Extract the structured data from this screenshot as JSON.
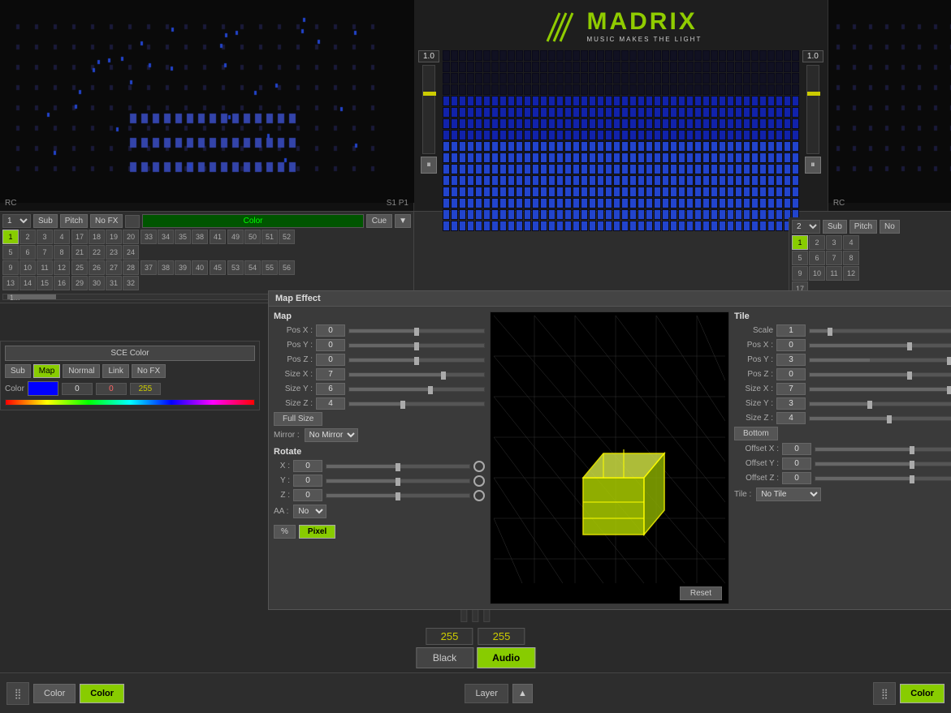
{
  "app": {
    "title": "MADRIX",
    "subtitle": "MUSIC MAKES THE LIGHT"
  },
  "left_channel": {
    "rc_label": "RC",
    "s1p1_label": "S1 P1",
    "strip_num": "1",
    "sub_btn": "Sub",
    "pitch_btn": "Pitch",
    "nofx_btn": "No FX",
    "color_label": "Color",
    "cue_btn": "Cue",
    "fader_value": "1.0",
    "scene_btn": "SCE Color",
    "sub2": "Sub",
    "map2": "Map",
    "normal2": "Normal",
    "link2": "Link",
    "nofx2": "No FX",
    "color_r": "0",
    "color_g": "0",
    "color_b": "255",
    "scroll_label": "1..."
  },
  "right_channel": {
    "rc_label": "RC",
    "strip_num": "2",
    "sub_btn": "Sub",
    "pitch_btn": "Pitch",
    "no_label": "No",
    "fader_value": "1.0"
  },
  "map_effect": {
    "title": "Map Effect",
    "map_section": "Map",
    "pos_x_label": "Pos X :",
    "pos_x_val": "0",
    "pos_y_label": "Pos Y :",
    "pos_y_val": "0",
    "pos_z_label": "Pos Z :",
    "pos_z_val": "0",
    "size_x_label": "Size X :",
    "size_x_val": "7",
    "size_y_label": "Size Y :",
    "size_y_val": "6",
    "size_z_label": "Size Z :",
    "size_z_val": "4",
    "full_size_btn": "Full Size",
    "mirror_label": "Mirror :",
    "mirror_val": "No Mirror",
    "rotate_section": "Rotate",
    "rot_x_label": "X :",
    "rot_x_val": "0",
    "rot_y_label": "Y :",
    "rot_y_val": "0",
    "rot_z_label": "Z :",
    "rot_z_val": "0",
    "aa_label": "AA :",
    "aa_val": "No",
    "pct_btn": "%",
    "pixel_btn": "Pixel",
    "reset_btn": "Reset"
  },
  "tile_panel": {
    "title": "Tile",
    "scale_label": "Scale",
    "scale_val": "1",
    "pos_x_label": "Pos X :",
    "pos_x_val": "0",
    "pos_y_label": "Pos Y :",
    "pos_y_val": "3",
    "pos_z_label": "Pos Z :",
    "pos_z_val": "0",
    "size_x_label": "Size X :",
    "size_x_val": "7",
    "size_y_label": "Size Y :",
    "size_y_val": "3",
    "size_z_label": "Size Z :",
    "size_z_val": "4",
    "bottom_btn": "Bottom",
    "offset_x_label": "Offset X :",
    "offset_x_val": "0",
    "offset_y_label": "Offset Y :",
    "offset_y_val": "0",
    "offset_z_label": "Offset Z :",
    "offset_z_val": "0",
    "tile_label": "Tile :",
    "tile_val": "No Tile"
  },
  "bottom_bar": {
    "color1_btn": "Color",
    "color2_btn": "Color",
    "color3_btn": "Color",
    "layer_btn": "Layer",
    "val_left": "255",
    "val_right": "255",
    "black_btn": "Black",
    "audio_btn": "Audio"
  },
  "grid_left": {
    "rows": [
      [
        "1",
        "2",
        "3",
        "4"
      ],
      [
        "5",
        "6",
        "7",
        "8"
      ],
      [
        "9",
        "10",
        "11",
        "12"
      ],
      [
        "13",
        "14",
        "15",
        "16"
      ]
    ],
    "rows2": [
      [
        "17",
        "18",
        "19",
        "20"
      ],
      [
        "21",
        "22",
        "23",
        "24"
      ],
      [
        "25",
        "26",
        "27",
        "28"
      ],
      [
        "29",
        "30",
        "31",
        "32"
      ]
    ],
    "rows3": [
      [
        "33",
        "34",
        "35",
        "38"
      ],
      [
        "37",
        "38",
        "39",
        "40"
      ],
      [
        "",
        "",
        "",
        ""
      ],
      [
        "",
        "",
        "",
        ""
      ]
    ],
    "rows4": [
      [
        "49",
        "50",
        "51",
        "52"
      ],
      [
        "53",
        "54",
        "55",
        "56"
      ],
      [
        "",
        "",
        "",
        ""
      ],
      [
        "",
        "",
        "",
        ""
      ]
    ]
  }
}
